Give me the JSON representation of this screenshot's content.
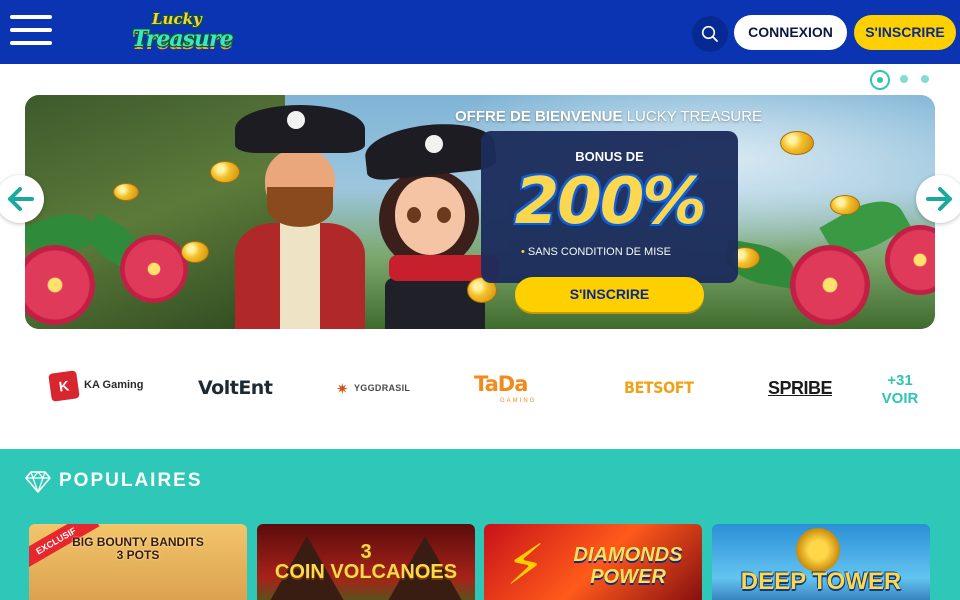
{
  "header": {
    "logo_line1": "Lucky",
    "logo_line2": "Treasure",
    "login_label": "CONNEXION",
    "signup_label": "S'INSCRIRE",
    "menu_icon": "hamburger-menu-icon",
    "search_icon": "search-icon",
    "background_color": "#0a34b2",
    "cta_color": "#ffd000"
  },
  "carousel": {
    "slide_count": 3,
    "active_slide": 1
  },
  "banner": {
    "offer_title_strong": "OFFRE DE BIENVENUE",
    "offer_title_light": "LUCKY TREASURE",
    "bonus_label": "BONUS DE",
    "bonus_value": "200%",
    "bonus_note_bullet": "•",
    "bonus_note": "SANS CONDITION DE MISE",
    "cta_label": "S'INSCRIRE",
    "prev_icon": "arrow-left-icon",
    "next_icon": "arrow-right-icon"
  },
  "providers": {
    "items": [
      {
        "name": "KA Gaming",
        "badge": "K"
      },
      {
        "name": "VoltEnt"
      },
      {
        "name": "YGGDRASIL"
      },
      {
        "name": "TaDa",
        "sub": "GAMING"
      },
      {
        "name": "BETSOFT"
      },
      {
        "name": "SPRIBE"
      }
    ],
    "more_count": "+31",
    "more_label": "VOIR",
    "accent_color": "#2ec4b6"
  },
  "popular": {
    "title": "POPULAIRES",
    "icon": "diamond-icon",
    "background_color": "#2fc8b8",
    "games": [
      {
        "title": "BIG BOUNTY BANDITS",
        "subtitle": "3 POTS",
        "badge": "EXCLUSIF"
      },
      {
        "title_number": "3",
        "title": "COIN VOLCANOES"
      },
      {
        "title": "DIAMONDS POWER"
      },
      {
        "title": "DEEP TOWER"
      }
    ]
  }
}
